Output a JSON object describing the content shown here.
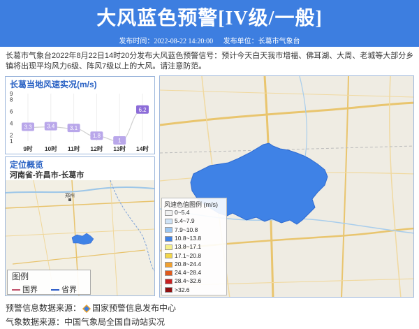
{
  "header": {
    "title": "大风蓝色预警[IV级/一般]",
    "publish_time": "发布时间：2022-08-22 14:20:00",
    "publisher": "发布单位：长葛市气象台",
    "bg_color": "#3d7ee0"
  },
  "description": "长葛市气象台2022年8月22日14时20分发布大风蓝色预警信号：预计今天白天我市增福、佛耳湖、大周、老城等大部分乡镇将出现平均风力6级、阵风7级以上的大风。请注意防范。",
  "wind_panel": {
    "title": "长葛当地风速实况(m/s)",
    "chart_data": {
      "type": "line",
      "categories": [
        "9时",
        "10时",
        "11时",
        "12时",
        "13时",
        "14时"
      ],
      "values": [
        3.3,
        3.4,
        3.1,
        1.8,
        1,
        6.2
      ],
      "y_ticks": [
        "1",
        "2",
        "4",
        "6",
        "8",
        "9"
      ],
      "line_color": "#8c6cd8"
    }
  },
  "location_panel": {
    "title": "定位概览",
    "region": "河南省-许昌市-长葛市",
    "legend": {
      "title": "图例",
      "items": [
        {
          "label": "国界",
          "color": "#c0506a"
        },
        {
          "label": "省界",
          "color": "#2a5ac8"
        }
      ]
    },
    "map_label": "郑州"
  },
  "wind_legend": {
    "title": "风速色值图例 (m/s)",
    "items": [
      {
        "label": "0~5.4",
        "color": "#f0f0f0"
      },
      {
        "label": "5.4~7.9",
        "color": "#cfe3f6"
      },
      {
        "label": "7.9~10.8",
        "color": "#9cc6f0"
      },
      {
        "label": "10.8~13.8",
        "color": "#3f82e6"
      },
      {
        "label": "13.8~17.1",
        "color": "#f6f08a"
      },
      {
        "label": "17.1~20.8",
        "color": "#f2d64a"
      },
      {
        "label": "20.8~24.4",
        "color": "#f0a030"
      },
      {
        "label": "24.4~28.4",
        "color": "#e05a1c"
      },
      {
        "label": "28.4~32.6",
        "color": "#c82020"
      },
      {
        "label": ">32.6",
        "color": "#901010"
      }
    ]
  },
  "footer": {
    "source_warning": "预警信息数据来源：",
    "source_warning_org": "国家预警信息发布中心",
    "source_weather": "气象数据来源：中国气象局全国自动站实况"
  }
}
